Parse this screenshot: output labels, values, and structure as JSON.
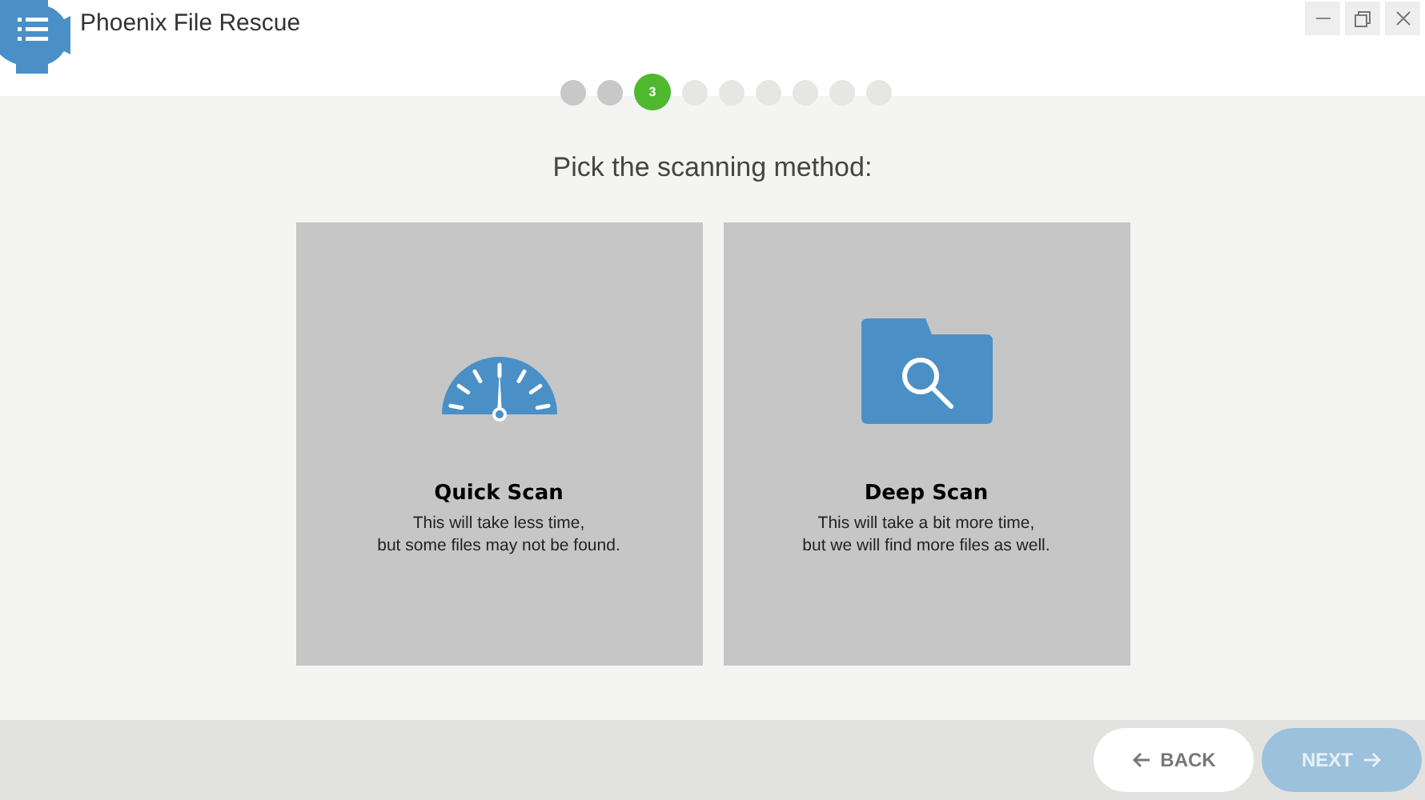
{
  "window": {
    "title": "Phoenix File Rescue"
  },
  "steps": [
    {
      "selected": false,
      "completed": true
    },
    {
      "selected": false,
      "completed": true
    },
    {
      "selected": true,
      "completed": false,
      "label": "3"
    },
    {
      "selected": false,
      "completed": false
    },
    {
      "selected": false,
      "completed": false
    },
    {
      "selected": false,
      "completed": false
    },
    {
      "selected": false,
      "completed": false
    },
    {
      "selected": false,
      "completed": false
    },
    {
      "selected": false,
      "completed": false
    }
  ],
  "heading": "Pick the scanning method:",
  "options": [
    {
      "kind": "gauge",
      "title": "Quick Scan",
      "lines": [
        "This will take less time,",
        "but some files may not be found."
      ]
    },
    {
      "kind": "folder",
      "title": "Deep Scan",
      "lines": [
        "This will take a bit more time,",
        "but we will find more files as well."
      ]
    }
  ],
  "buttons": {
    "back": {
      "label": "BACK",
      "disabled": false
    },
    "next": {
      "label": "NEXT",
      "disabled": true
    }
  }
}
